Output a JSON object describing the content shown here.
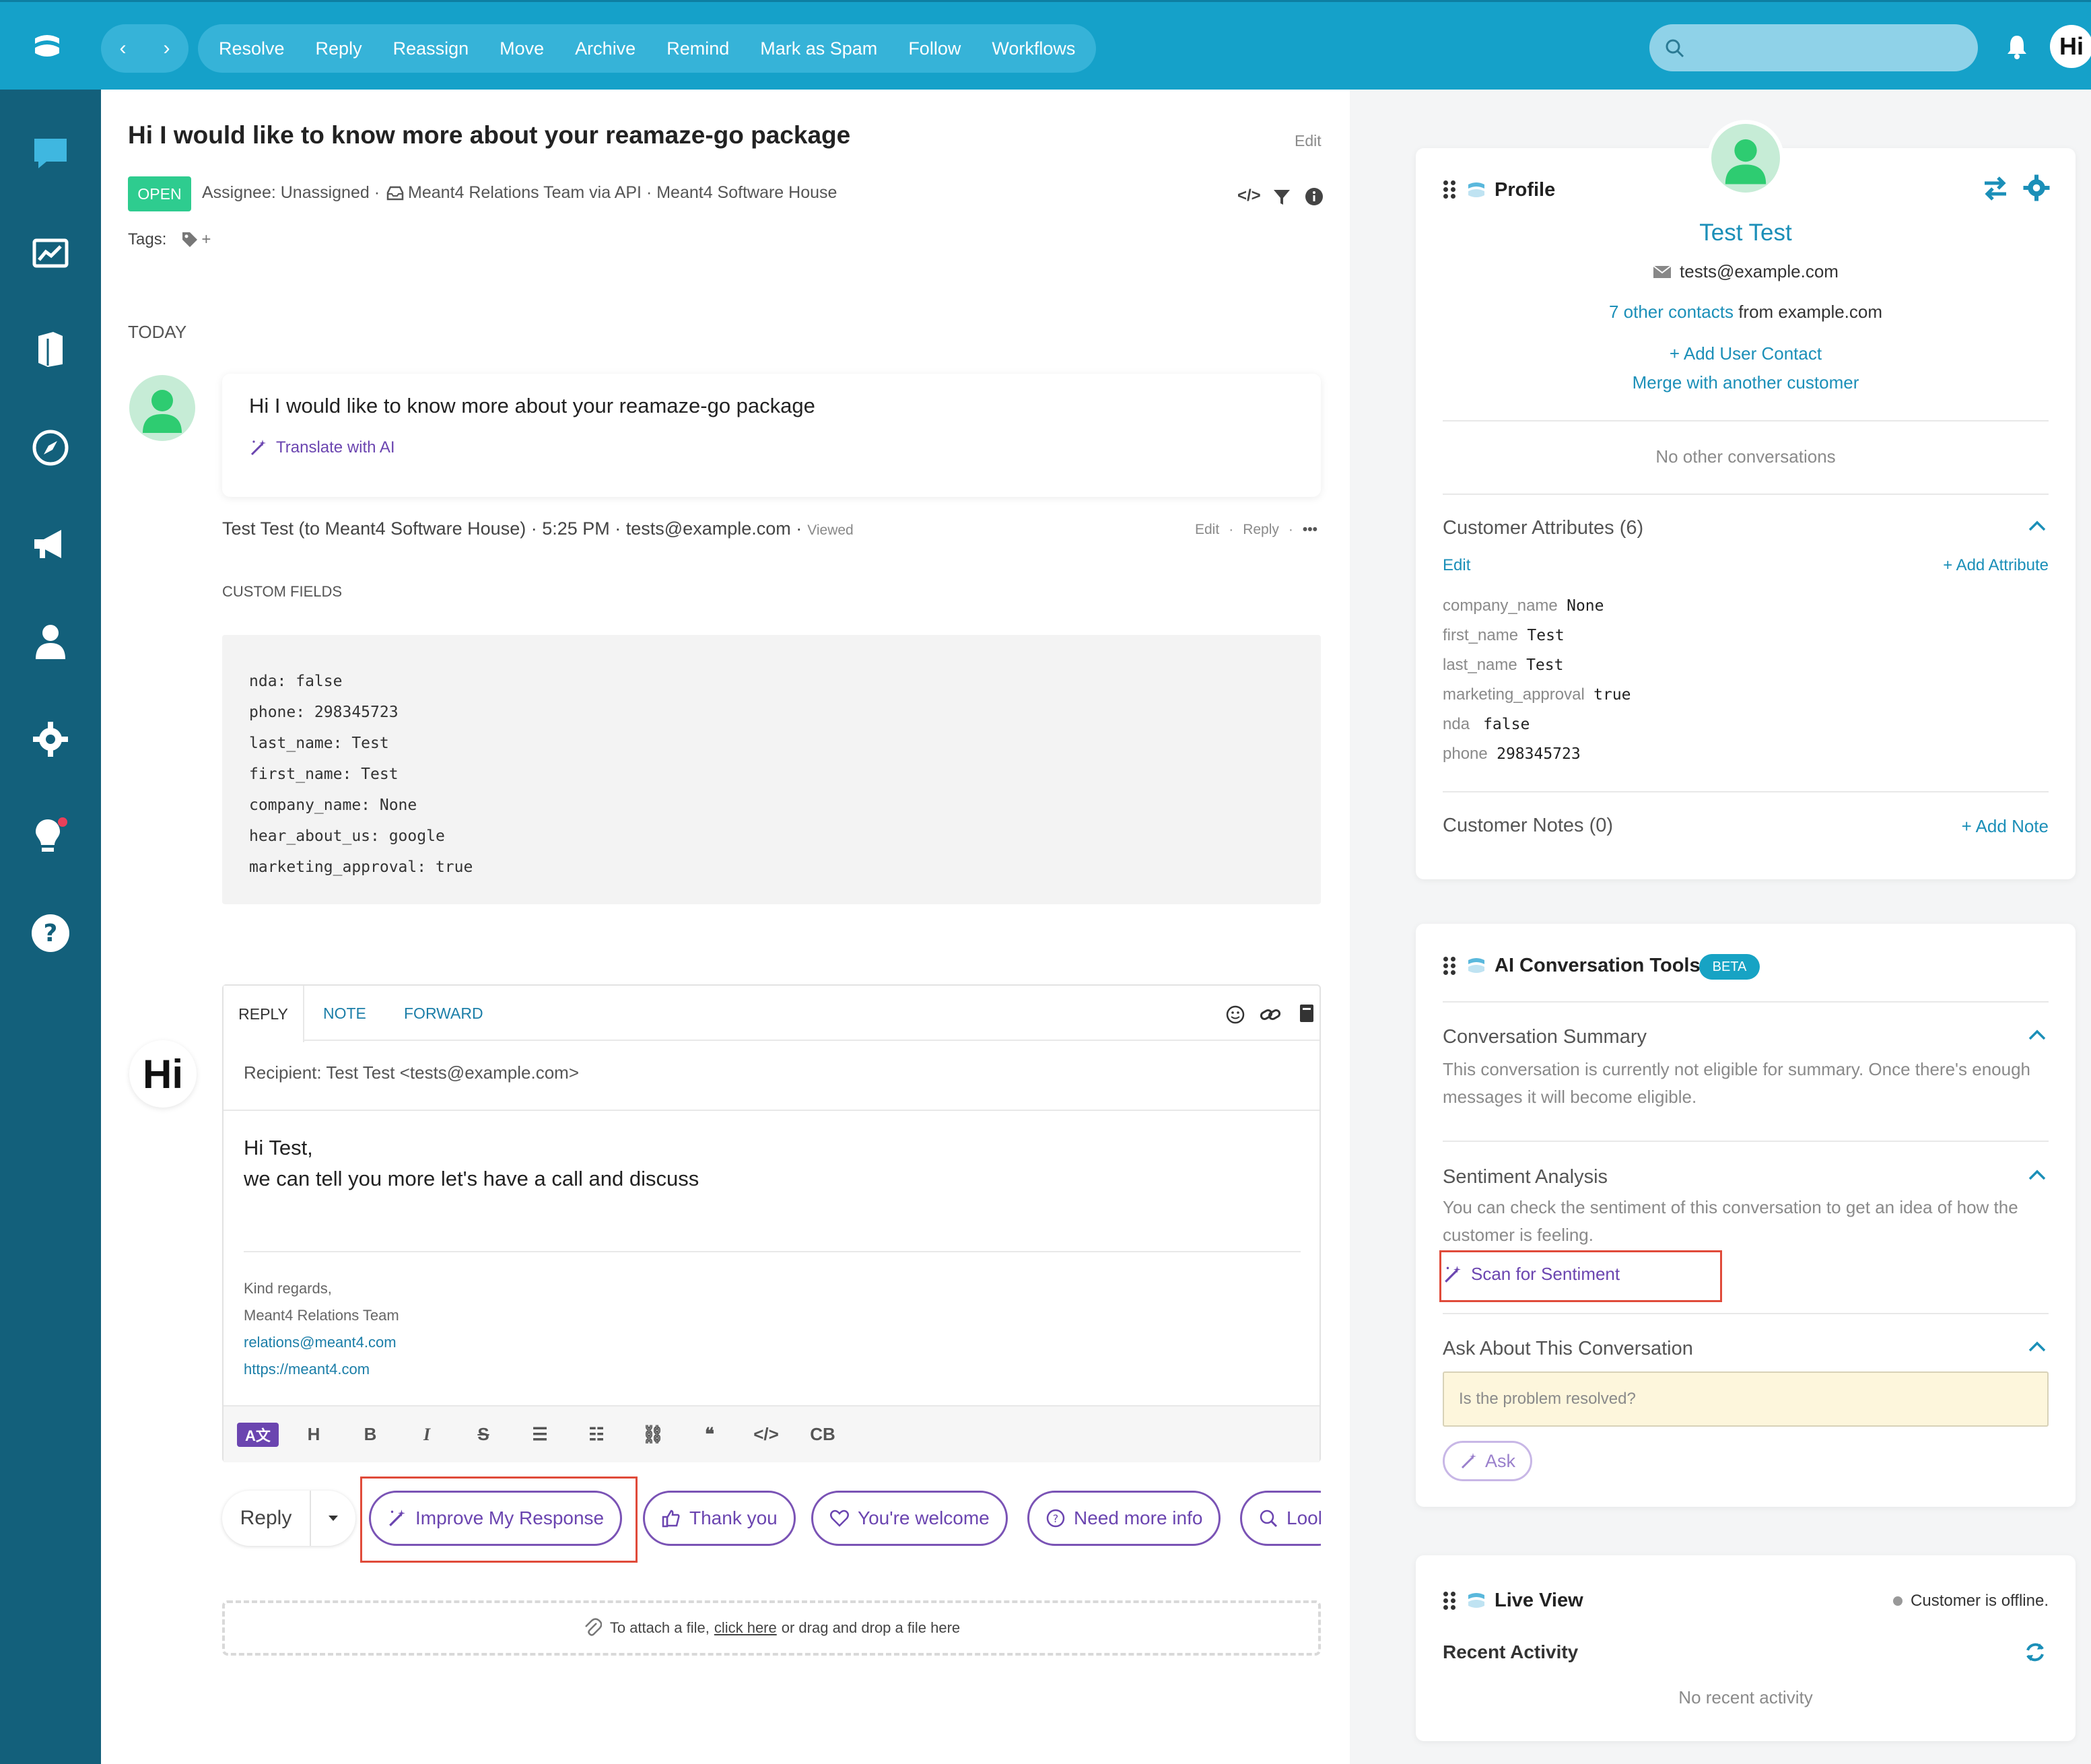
{
  "nav": {
    "buttons": [
      "Resolve",
      "Reply",
      "Reassign",
      "Move",
      "Archive",
      "Remind",
      "Mark as Spam",
      "Follow",
      "Workflows"
    ],
    "search_placeholder": ""
  },
  "conversation": {
    "title": "Hi I would like to know more about your reamaze-go package",
    "edit_label": "Edit",
    "status": "OPEN",
    "meta_assignee": "Assignee: Unassigned ·",
    "meta_source": "Meant4 Relations Team via API · Meant4 Software House",
    "tags_label": "Tags:",
    "tags_add": "+",
    "date_header": "TODAY",
    "message_text": "Hi I would like to know more about your reamaze-go package",
    "translate_label": "Translate with AI",
    "message_meta": "Test Test (to Meant4 Software House) · 5:25 PM · tests@example.com ·",
    "viewed_label": "Viewed",
    "msg_edit": "Edit",
    "msg_reply": "Reply",
    "msg_more": "•••",
    "custom_fields_label": "CUSTOM FIELDS",
    "custom_fields": [
      "nda: false",
      "phone: 298345723",
      "last_name: Test",
      "first_name: Test",
      "company_name: None",
      "hear_about_us: google",
      "marketing_approval: true"
    ]
  },
  "reply_box": {
    "tabs": [
      "REPLY",
      "NOTE",
      "FORWARD"
    ],
    "recipient": "Recipient: Test Test <tests@example.com>",
    "body_line1": "Hi Test,",
    "body_line2": "we can tell you more let's have a call and discuss",
    "sig_regards": "Kind regards,",
    "sig_team": "Meant4 Relations Team",
    "sig_email": "relations@meant4.com",
    "sig_url": "https://meant4.com",
    "toolbar": [
      "H",
      "B",
      "I",
      "S",
      "☰",
      "☷",
      "⛓",
      "❝",
      "</>",
      "CB"
    ],
    "translate_badge": "A文",
    "reply_button": "Reply",
    "chips": [
      "Improve My Response",
      "Thank you",
      "You're welcome",
      "Need more info",
      "Look"
    ],
    "attach_prefix": "To attach a file,",
    "attach_link": "click here",
    "attach_suffix": "or drag and drop a file here"
  },
  "profile": {
    "panel_title": "Profile",
    "name": "Test Test",
    "email": "tests@example.com",
    "other_contacts_link": "7 other contacts",
    "other_contacts_suffix": "from example.com",
    "add_user_contact": "+ Add User Contact",
    "merge": "Merge with another customer",
    "no_other_conversations": "No other conversations",
    "attributes_title": "Customer Attributes (6)",
    "attributes_edit": "Edit",
    "add_attribute": "+ Add Attribute",
    "attributes": [
      {
        "key": "company_name",
        "value": "None"
      },
      {
        "key": "first_name",
        "value": "Test"
      },
      {
        "key": "last_name",
        "value": "Test"
      },
      {
        "key": "marketing_approval",
        "value": "true"
      },
      {
        "key": "nda",
        "value": "false"
      },
      {
        "key": "phone",
        "value": "298345723"
      }
    ],
    "notes_title": "Customer Notes (0)",
    "add_note": "+ Add Note"
  },
  "ai_tools": {
    "title": "AI Conversation Tools",
    "beta": "BETA",
    "summary_title": "Conversation Summary",
    "summary_text": "This conversation is currently not eligible for summary. Once there's enough messages it will become eligible.",
    "sentiment_title": "Sentiment Analysis",
    "sentiment_text": "You can check the sentiment of this conversation to get an idea of how the customer is feeling.",
    "scan_button": "Scan for Sentiment",
    "ask_title": "Ask About This Conversation",
    "ask_placeholder": "Is the problem resolved?",
    "ask_button": "Ask"
  },
  "live_view": {
    "title": "Live View",
    "status": "Customer is offline.",
    "recent_title": "Recent Activity",
    "no_activity": "No recent activity"
  },
  "user_badge": "Hi",
  "colors": {
    "topbar": "#15a1c9",
    "sidebar": "#13607b",
    "accent": "#1b8fb8",
    "ai_purple": "#6b45b0",
    "open_badge": "#2ecc8f",
    "highlight_box": "#e04b3a"
  }
}
